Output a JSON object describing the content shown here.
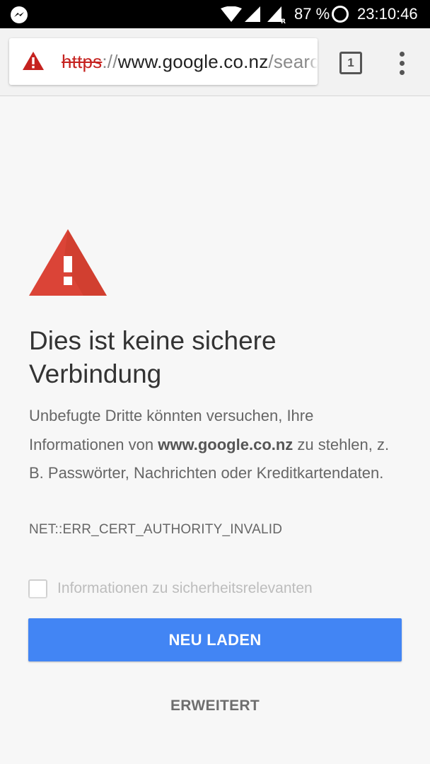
{
  "status_bar": {
    "battery": "87 %",
    "time": "23:10:46",
    "icons": [
      "messenger-icon",
      "wifi-icon",
      "signal-icon",
      "roaming-signal-icon",
      "battery-icon"
    ]
  },
  "toolbar": {
    "url": {
      "scheme": "https",
      "separator": "://",
      "host": "www.google.co.nz",
      "path": "/search"
    },
    "tab_count": "1"
  },
  "interstitial": {
    "title": "Dies ist keine sichere Verbindung",
    "desc_before": "Unbefugte Dritte könnten versuchen, Ihre Informationen von ",
    "desc_host": "www.google.co.nz",
    "desc_after": " zu stehlen, z. B. Passwörter, Nachrichten oder Kreditkartendaten.",
    "error_code": "NET::ERR_CERT_AUTHORITY_INVALID",
    "checkbox_label": "Informationen zu sicherheitsrelevanten",
    "reload_label": "NEU LADEN",
    "advanced_label": "ERWEITERT"
  },
  "colors": {
    "warning_red": "#db4437",
    "scheme_red": "#c5221f",
    "primary_blue": "#4285f4"
  }
}
